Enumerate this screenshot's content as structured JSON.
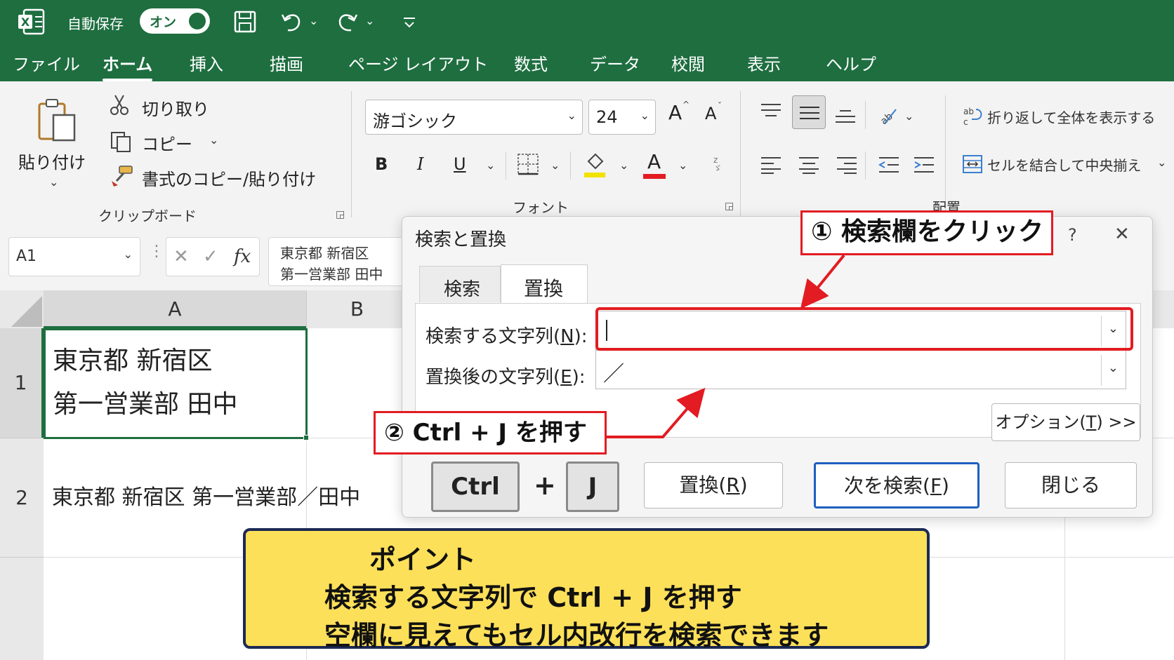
{
  "titlebar": {
    "autosave_label": "自動保存",
    "autosave_state": "オン"
  },
  "menu": [
    "ファイル",
    "ホーム",
    "挿入",
    "描画",
    "ページ レイアウト",
    "数式",
    "データ",
    "校閲",
    "表示",
    "ヘルプ"
  ],
  "ribbon": {
    "clipboard": {
      "paste": "貼り付け",
      "cut": "切り取り",
      "copy": "コピー",
      "format_painter": "書式のコピー/貼り付け",
      "group_label": "クリップボード"
    },
    "font": {
      "font_name": "游ゴシック",
      "font_size": "24",
      "grow": "A",
      "shrink": "A",
      "bold": "B",
      "italic": "I",
      "underline": "U",
      "font_color_glyph": "A",
      "group_label": "フォント"
    },
    "alignment": {
      "wrap_text": "折り返して全体を表示する",
      "merge_center": "セルを結合して中央揃え",
      "group_label": "配置"
    }
  },
  "formula_bar": {
    "name_box": "A1",
    "fx": "fx",
    "content_line1": "東京都 新宿区",
    "content_line2": "第一営業部 田中"
  },
  "sheet": {
    "col_a": "A",
    "col_b": "B",
    "row1": "1",
    "row2": "2",
    "a1_line1": "東京都 新宿区",
    "a1_line2": "第一営業部 田中",
    "a2": "東京都 新宿区 第一営業部／田中"
  },
  "dialog": {
    "title": "検索と置換",
    "help": "?",
    "close": "✕",
    "tab_find": "検索",
    "tab_replace": "置換",
    "find_label_pre": "検索する文字列(",
    "find_label_key": "N",
    "find_label_post": "):",
    "replace_label_pre": "置換後の文字列(",
    "replace_label_key": "E",
    "replace_label_post": "):",
    "replace_value": "／",
    "options_pre": "オプション(",
    "options_key": "T",
    "options_post": ") >>",
    "replace_btn_pre": "置換(",
    "replace_btn_key": "R",
    "replace_btn_post": ")",
    "find_next_pre": "次を検索(",
    "find_next_key": "F",
    "find_next_post": ")",
    "close_btn": "閉じる"
  },
  "keys": {
    "ctrl": "Ctrl",
    "plus": "+",
    "j": "J"
  },
  "annotations": {
    "step1": "① 検索欄をクリック",
    "step2": "② Ctrl + J を押す",
    "point_title": "ポイント",
    "point_line1": "検索する文字列で Ctrl + J を押す",
    "point_line2": "空欄に見えてもセル内改行を検索できます"
  },
  "colors": {
    "excel_green": "#1e6e40",
    "callout_red": "#e21c22",
    "point_yellow": "#fde05a",
    "primary_blue": "#1f5fbf"
  }
}
